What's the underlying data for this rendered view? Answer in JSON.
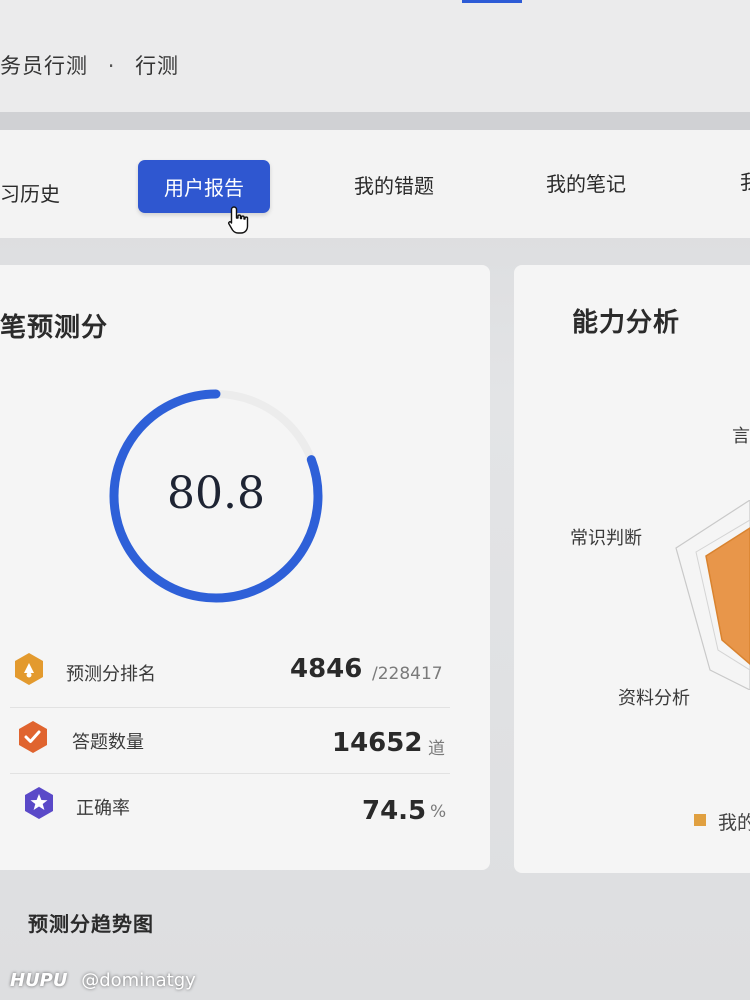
{
  "header": {
    "breadcrumb_part1": "务员行测",
    "breadcrumb_sep": "·",
    "breadcrumb_part2": "行测"
  },
  "tabs": [
    {
      "label": "习历史"
    },
    {
      "label": "用户报告",
      "active": true
    },
    {
      "label": "我的错题"
    },
    {
      "label": "我的笔记"
    },
    {
      "label": "我"
    }
  ],
  "score_card": {
    "title": "笔预测分",
    "score": "80.8",
    "score_progress": 0.808,
    "stats": [
      {
        "label": "预测分排名",
        "value": "4846",
        "unit": "/228417",
        "icon": "rank-badge-icon",
        "color": "#e39a2e"
      },
      {
        "label": "答题数量",
        "value": "14652",
        "unit": "道",
        "icon": "answer-count-icon",
        "color": "#e0642f"
      },
      {
        "label": "正确率",
        "value": "74.5",
        "unit": "%",
        "icon": "star-accuracy-icon",
        "color": "#5a49c8"
      }
    ]
  },
  "ability_card": {
    "title": "能力分析",
    "axis_labels": [
      "言",
      "常识判断",
      "资料分析"
    ],
    "legend": "我的",
    "fill_color": "#e8964a"
  },
  "trend": {
    "title": "预测分趋势图"
  },
  "watermark": {
    "brand": "HUPU",
    "user": "@dominatgy"
  },
  "colors": {
    "accent": "#2f57d0",
    "ring": "#2e60d8"
  }
}
